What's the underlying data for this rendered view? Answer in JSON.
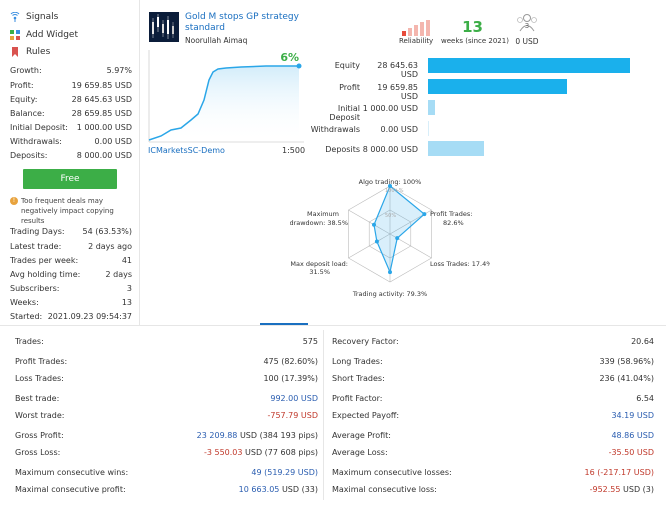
{
  "sidebar": {
    "menu": [
      {
        "label": "Signals",
        "icon": "signal-icon"
      },
      {
        "label": "Add Widget",
        "icon": "widget-icon"
      },
      {
        "label": "Rules",
        "icon": "bookmark-icon"
      }
    ],
    "stats": [
      {
        "label": "Growth:",
        "value": "5.97%"
      },
      {
        "label": "Profit:",
        "value": "19 659.85 USD"
      },
      {
        "label": "Equity:",
        "value": "28 645.63 USD"
      },
      {
        "label": "Balance:",
        "value": "28 659.85 USD"
      },
      {
        "label": "Initial Deposit:",
        "value": "1 000.00 USD"
      },
      {
        "label": "Withdrawals:",
        "value": "0.00 USD"
      },
      {
        "label": "Deposits:",
        "value": "8 000.00 USD"
      }
    ],
    "free_button": "Free",
    "warning": "Too frequent deals may negatively impact copying results",
    "activity": [
      {
        "label": "Trading Days:",
        "value": "54 (63.53%)"
      },
      {
        "label": "Latest trade:",
        "value": "2 days ago"
      },
      {
        "label": "Trades per week:",
        "value": "41"
      },
      {
        "label": "Avg holding time:",
        "value": "2 days"
      },
      {
        "label": "Subscribers:",
        "value": "3"
      },
      {
        "label": "Weeks:",
        "value": "13"
      },
      {
        "label": "Started:",
        "value": "2021.09.23 09:54:37"
      }
    ]
  },
  "signal": {
    "title": "Gold M stops GP strategy standard",
    "author": "Noorullah Aimaq",
    "growth_percent": "6%",
    "broker": "ICMarketsSC-Demo",
    "leverage": "1:500"
  },
  "header": {
    "reliability_label": "Reliability",
    "weeks_value": "13",
    "weeks_label": "weeks (since 2021)",
    "subscribers_badge": "3",
    "subscribers_value": "0 USD"
  },
  "bars": [
    {
      "label": "Equity",
      "value": "28 645.63 USD",
      "fraction": 1.0,
      "color": "#1ab0ec"
    },
    {
      "label": "Profit",
      "value": "19 659.85 USD",
      "fraction": 0.686,
      "color": "#1ab0ec"
    },
    {
      "label": "Initial Deposit",
      "value": "1 000.00 USD",
      "fraction": 0.035,
      "color": "#a6dcf5"
    },
    {
      "label": "Withdrawals",
      "value": "0.00 USD",
      "fraction": 0.0,
      "color": "#a6dcf5"
    },
    {
      "label": "Deposits",
      "value": "8 000.00 USD",
      "fraction": 0.279,
      "color": "#a6dcf5"
    }
  ],
  "radar": {
    "algo": "Algo trading: 100%",
    "profit_trades_l1": "Profit Trades:",
    "profit_trades_l2": "82.6%",
    "loss_trades": "Loss Trades: 17.4%",
    "trading_activity": "Trading activity: 79.3%",
    "max_deposit_l1": "Max deposit load:",
    "max_deposit_l2": "31.5%",
    "max_drawdown_l1": "Maximum",
    "max_drawdown_l2": "drawdown: 38.5%",
    "ring_100": "100+%",
    "ring_50": "50%",
    "values": [
      1.0,
      0.826,
      0.174,
      0.793,
      0.315,
      0.385
    ]
  },
  "stats_left": [
    {
      "label": "Trades:",
      "value": "575",
      "pips": "",
      "cls": ""
    },
    {
      "label": "Profit Trades:",
      "value": "475 (82.60%)",
      "pips": "",
      "cls": ""
    },
    {
      "label": "Loss Trades:",
      "value": "100 (17.39%)",
      "pips": "",
      "cls": ""
    },
    {
      "label": "Best trade:",
      "value": "992.00 USD",
      "pips": "",
      "cls": "blue"
    },
    {
      "label": "Worst trade:",
      "value": "-757.79 USD",
      "pips": "",
      "cls": "red"
    },
    {
      "label": "Gross Profit:",
      "value": "23 209.88",
      "pips": "USD (384 193 pips)",
      "cls": "blue"
    },
    {
      "label": "Gross Loss:",
      "value": "-3 550.03",
      "pips": "USD (77 608 pips)",
      "cls": "red"
    },
    {
      "label": "Maximum consecutive wins:",
      "value": "49",
      "pips": "(519.29 USD)",
      "cls": "blue2"
    },
    {
      "label": "Maximal consecutive profit:",
      "value": "10 663.05",
      "pips": "USD (33)",
      "cls": "blue"
    }
  ],
  "stats_right": [
    {
      "label": "Recovery Factor:",
      "value": "20.64",
      "pips": "",
      "cls": ""
    },
    {
      "label": "Long Trades:",
      "value": "339 (58.96%)",
      "pips": "",
      "cls": ""
    },
    {
      "label": "Short Trades:",
      "value": "236 (41.04%)",
      "pips": "",
      "cls": ""
    },
    {
      "label": "Profit Factor:",
      "value": "6.54",
      "pips": "",
      "cls": ""
    },
    {
      "label": "Expected Payoff:",
      "value": "34.19 USD",
      "pips": "",
      "cls": "blue"
    },
    {
      "label": "Average Profit:",
      "value": "48.86 USD",
      "pips": "",
      "cls": "blue"
    },
    {
      "label": "Average Loss:",
      "value": "-35.50 USD",
      "pips": "",
      "cls": "red"
    },
    {
      "label": "Maximum consecutive losses:",
      "value": "16",
      "pips": "(-217.17 USD)",
      "cls": "red2"
    },
    {
      "label": "Maximal consecutive loss:",
      "value": "-952.55",
      "pips": "USD (3)",
      "cls": "red"
    }
  ]
}
